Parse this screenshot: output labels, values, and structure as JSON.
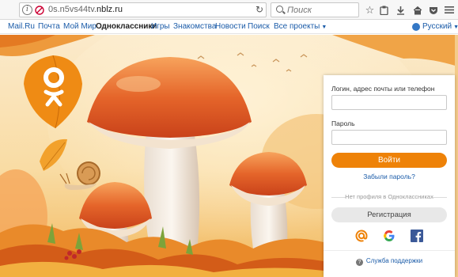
{
  "browser": {
    "url_prefix": "0s.n5vs44tv.",
    "url_domain": "nblz.ru",
    "search_placeholder": "Поиск",
    "icons": [
      "info-icon",
      "site-icon",
      "reload-icon",
      "search-icon",
      "star-icon",
      "clipboard-icon",
      "download-icon",
      "home-icon",
      "pocket-icon",
      "menu-icon"
    ]
  },
  "portal": {
    "links": [
      "Mail.Ru",
      "Почта",
      "Мой Мир",
      "Одноклассники",
      "Игры",
      "Знакомства",
      "Новости",
      "Поиск",
      "Все проекты"
    ],
    "active": "Одноклассники",
    "language": "Русский"
  },
  "login": {
    "login_label": "Логин, адрес почты или телефон",
    "password_label": "Пароль",
    "login_button": "Войти",
    "forgot_password": "Забыли пароль?",
    "no_profile": "Нет профиля в Одноклассниках",
    "register_button": "Регистрация",
    "social": [
      "mailru-icon",
      "google-icon",
      "facebook-icon"
    ],
    "support": "Служба поддержки"
  },
  "colors": {
    "accent": "#ee8208",
    "link": "#1a5ba8",
    "facebook": "#3b5998"
  }
}
